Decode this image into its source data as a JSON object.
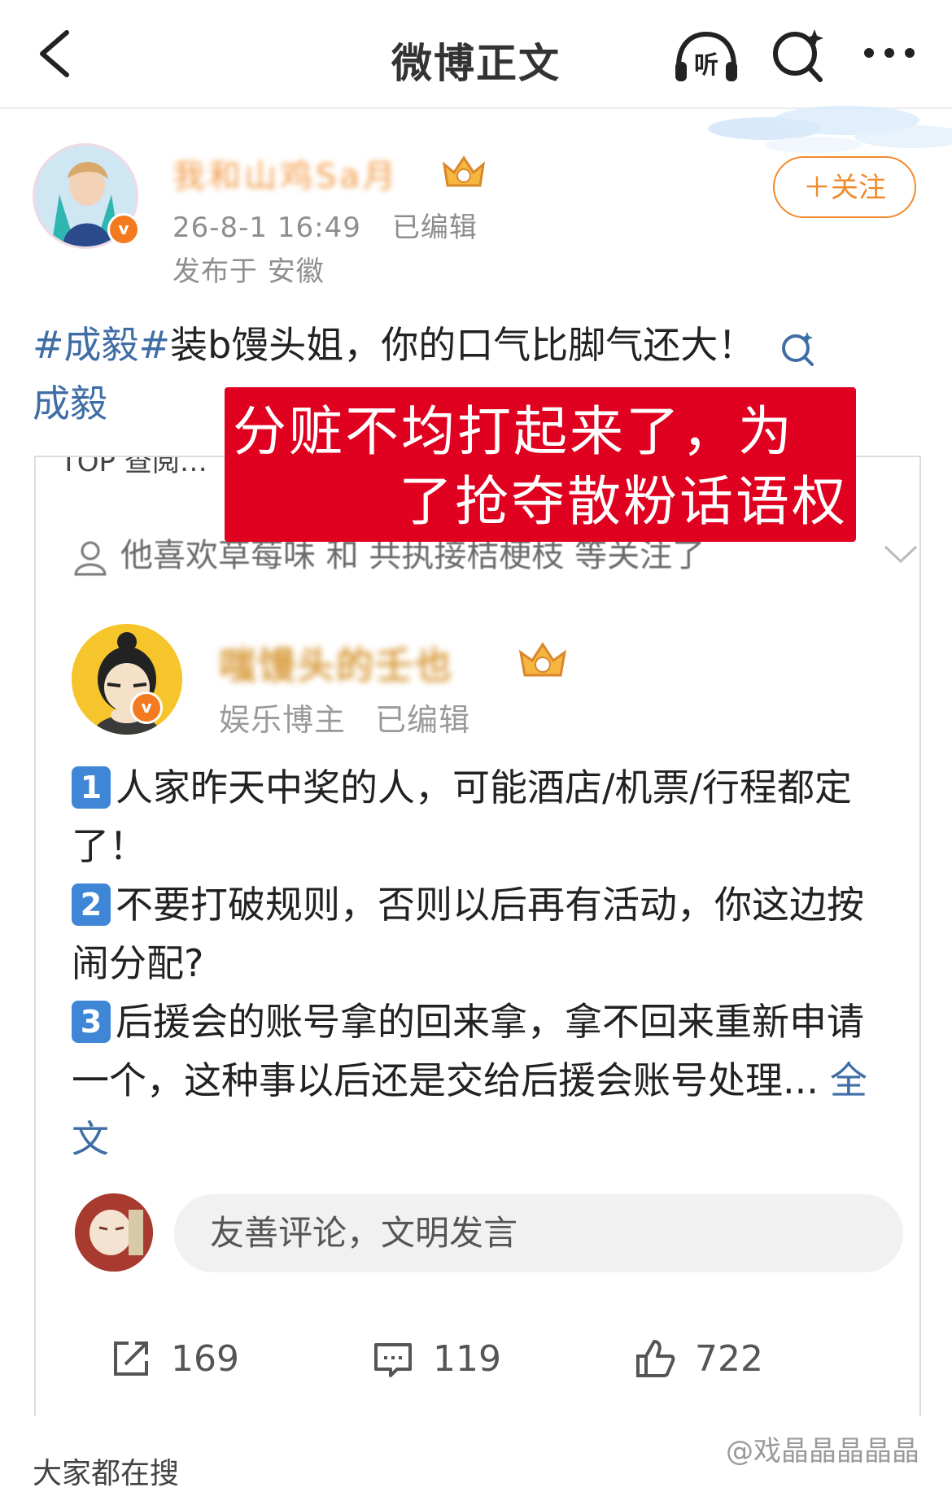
{
  "nav": {
    "title": "微博正文",
    "listen_label": "听"
  },
  "post": {
    "username": "我和山鸡Sa月",
    "date": "26-8-1 16:49",
    "edited": "已编辑",
    "location": "发布于 安徽",
    "follow_label": "＋关注",
    "tag1": "#成毅#",
    "text": "装b馒头姐，你的口气比脚气还大！",
    "tag2": "成毅"
  },
  "overlay": {
    "line1": "分赃不均打起来了，为",
    "line2": "了抢夺散粉话语权"
  },
  "card": {
    "cut_text": "TOP 查阅…",
    "liked_text": "他喜欢草莓味 和 共执接桔梗枝 等关注了",
    "author_name": "嗤馒头的壬也",
    "author_role": "娱乐博主",
    "author_edited": "已编辑",
    "points": [
      {
        "num": "1",
        "text": "人家昨天中奖的人，可能酒店/机票/行程都定了！"
      },
      {
        "num": "2",
        "text": "不要打破规则，否则以后再有活动，你这边按闹分配?"
      },
      {
        "num": "3",
        "text": "后援会的账号拿的回来拿，拿不回来重新申请一个，这种事以后还是交给后援会账号处理..."
      }
    ],
    "full_text_link": "全文",
    "comment_placeholder": "友善评论，文明发言",
    "repost_count": "169",
    "comment_count": "119",
    "like_count": "722"
  },
  "bottom": {
    "cut_text": "大家都在搜",
    "watermark": "@戏晶晶晶晶晶"
  },
  "colors": {
    "accent_orange": "#f18a2e",
    "link_blue": "#3f6ea6",
    "overlay_red": "#e0001f",
    "vip_badge": "#f47a1f"
  }
}
